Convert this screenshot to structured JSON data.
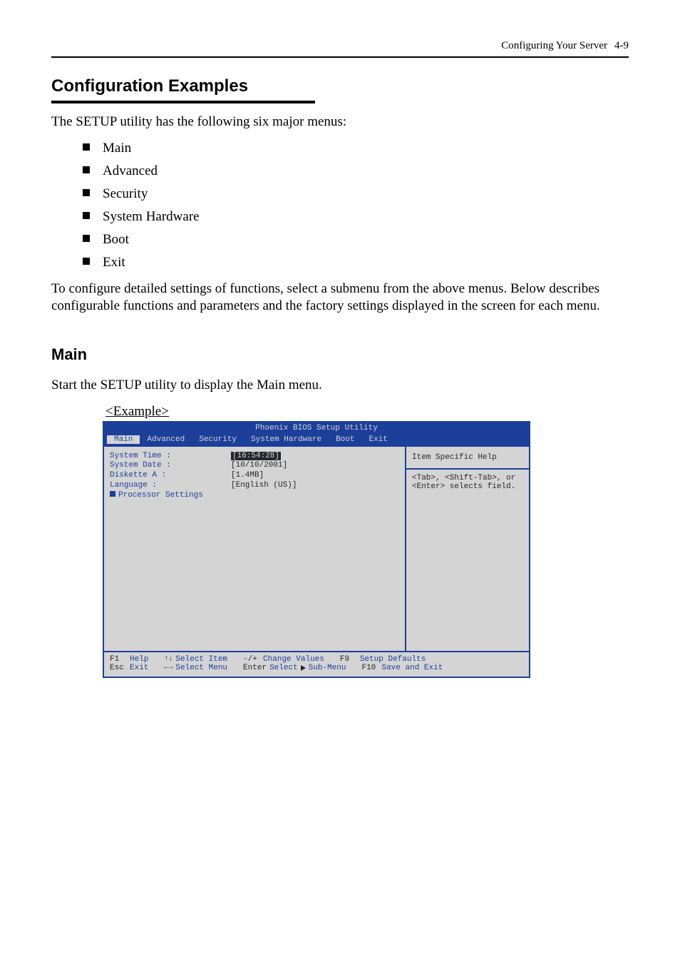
{
  "page": {
    "header_section": "Configuring Your Server",
    "header_page": "4-9",
    "section_heading": "Configuration Examples",
    "intro": "The SETUP utility has the following six major menus:",
    "menus": [
      "Main",
      "Advanced",
      "Security",
      "System Hardware",
      "Boot",
      "Exit"
    ],
    "intro2": "To configure detailed settings of functions, select a submenu from the above menus. Below describes configurable functions and parameters and the factory settings displayed in the screen for each menu.",
    "sub_heading": "Main",
    "sub_body": "Start the SETUP utility to display the Main menu.",
    "example_label": "<Example>"
  },
  "bios": {
    "title": "Phoenix BIOS Setup Utility",
    "tabs": [
      "Main",
      "Advanced",
      "Security",
      "System Hardware",
      "Boot",
      "Exit"
    ],
    "active_tab": 0,
    "help_title": "Item Specific Help",
    "help_body": "<Tab>, <Shift-Tab>, or <Enter> selects field.",
    "fields": [
      {
        "k": "System Time :",
        "v": "[16:54:28]",
        "hl": true
      },
      {
        "k": "System Date :",
        "v": "[10/10/2001]",
        "hl": false
      },
      {
        "k": "",
        "v": ""
      },
      {
        "k": "Diskette A :",
        "v": "[1.4MB]",
        "hl": false
      },
      {
        "k": "",
        "v": ""
      },
      {
        "k": "Language :",
        "v": "[English (US)]",
        "hl": false
      },
      {
        "k": "",
        "v": ""
      },
      {
        "k": "Processor Settings",
        "v": "",
        "proc": true,
        "hl": false
      }
    ],
    "footer": [
      {
        "key": "F1",
        "label": "Help"
      },
      {
        "key": "arrows",
        "label": "Select Item"
      },
      {
        "key": "-/+",
        "label": "Change Values"
      },
      {
        "key": "F9",
        "label": "Setup Defaults"
      },
      {
        "key": "Esc",
        "label": "Exit"
      },
      {
        "key": "lr",
        "label": "Select Menu"
      },
      {
        "key": "Enter",
        "label": "Select",
        "sub": true
      },
      {
        "key": "",
        "label": "Sub-Menu"
      },
      {
        "key": "F10",
        "label": "Save and Exit"
      }
    ]
  }
}
